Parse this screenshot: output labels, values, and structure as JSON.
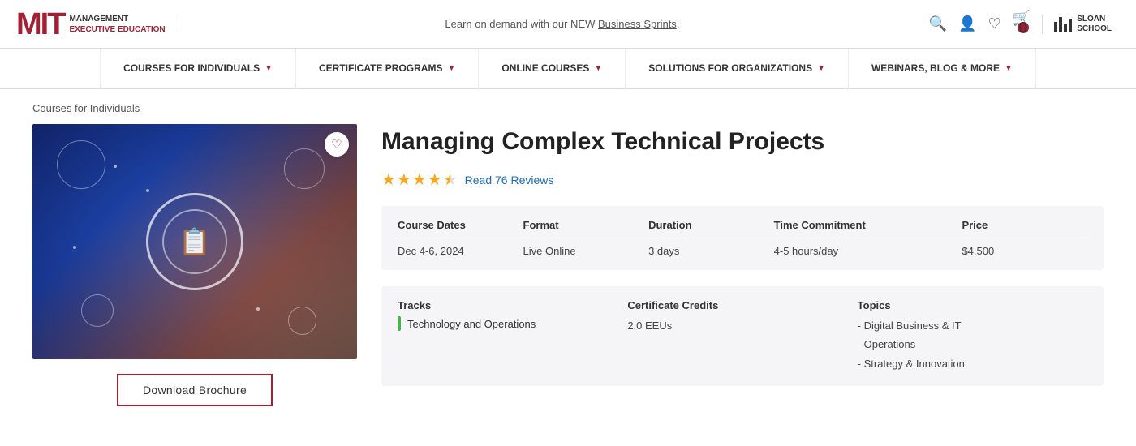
{
  "header": {
    "logo_mit": "MIT",
    "logo_management": "MANAGEMENT",
    "logo_exec": "EXECUTIVE EDUCATION",
    "banner_text": "Learn on demand with our NEW ",
    "banner_link": "Business Sprints",
    "banner_suffix": ".",
    "sloan_line1": "SLOAN",
    "sloan_line2": "SCHOOL"
  },
  "nav": {
    "items": [
      {
        "label": "COURSES FOR INDIVIDUALS",
        "id": "courses-individuals"
      },
      {
        "label": "CERTIFICATE PROGRAMS",
        "id": "certificate-programs"
      },
      {
        "label": "ONLINE COURSES",
        "id": "online-courses"
      },
      {
        "label": "SOLUTIONS FOR ORGANIZATIONS",
        "id": "solutions-orgs"
      },
      {
        "label": "WEBINARS, BLOG & MORE",
        "id": "webinars-blog"
      }
    ]
  },
  "breadcrumb": "Courses for Individuals",
  "course": {
    "title": "Managing Complex Technical Projects",
    "stars_full": "★★★★",
    "stars_half": "½",
    "review_text": "Read 76 Reviews",
    "table": {
      "headers": [
        "Course Dates",
        "Format",
        "Duration",
        "Time Commitment",
        "Price"
      ],
      "row": [
        "Dec 4-6, 2024",
        "Live Online",
        "3 days",
        "4-5 hours/day",
        "$4,500"
      ]
    },
    "tracks_label": "Tracks",
    "track_value": "Technology and Operations",
    "credits_label": "Certificate Credits",
    "credits_value": "2.0 EEUs",
    "topics_label": "Topics",
    "topics": [
      "- Digital Business & IT",
      "- Operations",
      "- Strategy & Innovation"
    ]
  },
  "buttons": {
    "download_brochure": "Download Brochure"
  }
}
